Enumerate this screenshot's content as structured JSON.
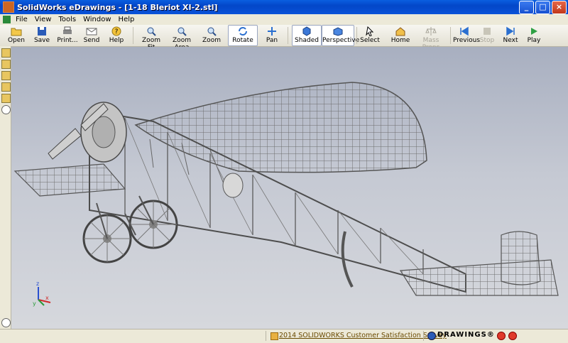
{
  "window": {
    "title": "SolidWorks eDrawings - [1-18 Bleriot XI-2.stl]",
    "minimize": "_",
    "maximize": "□",
    "close": "×"
  },
  "menu": {
    "items": [
      "File",
      "View",
      "Tools",
      "Window",
      "Help"
    ]
  },
  "toolbar": {
    "open": "Open",
    "save": "Save",
    "print": "Print...",
    "send": "Send",
    "help": "Help",
    "zoom_fit": "Zoom Fit",
    "zoom_area": "Zoom Area",
    "zoom": "Zoom",
    "rotate": "Rotate",
    "pan": "Pan",
    "shaded": "Shaded",
    "perspective": "Perspective",
    "select": "Select",
    "home": "Home",
    "mass_props": "Mass Props",
    "previous": "Previous",
    "stop": "Stop",
    "next": "Next",
    "play": "Play"
  },
  "triad": {
    "x": "x",
    "y": "y",
    "z": "z"
  },
  "status": {
    "survey_link": "2014 SOLIDWORKS Customer Satisfaction Survey",
    "brand": "DRAWINGS®"
  }
}
